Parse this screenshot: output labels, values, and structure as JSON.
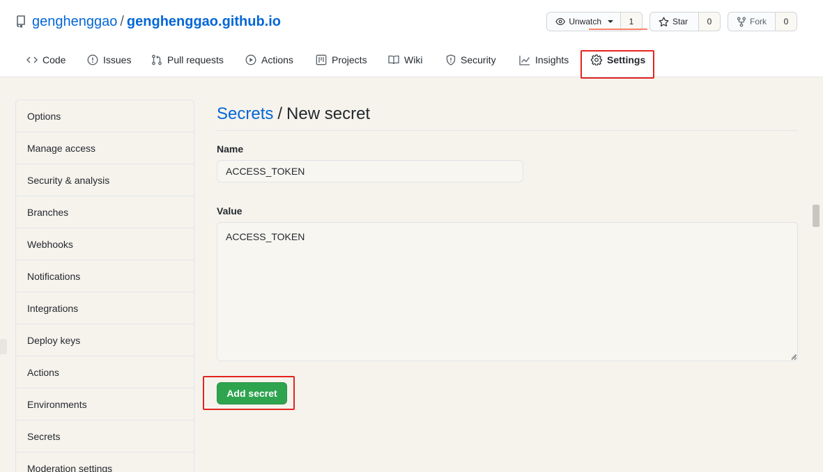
{
  "repo": {
    "owner": "genghenggao",
    "separator": "/",
    "name": "genghenggao.github.io"
  },
  "actions": {
    "watch": {
      "label": "Unwatch",
      "count": "1"
    },
    "star": {
      "label": "Star",
      "count": "0"
    },
    "fork": {
      "label": "Fork",
      "count": "0"
    }
  },
  "tabs": [
    {
      "label": "Code",
      "icon": "code-icon"
    },
    {
      "label": "Issues",
      "icon": "issue-icon"
    },
    {
      "label": "Pull requests",
      "icon": "pull-request-icon"
    },
    {
      "label": "Actions",
      "icon": "play-icon"
    },
    {
      "label": "Projects",
      "icon": "project-icon"
    },
    {
      "label": "Wiki",
      "icon": "book-icon"
    },
    {
      "label": "Security",
      "icon": "shield-icon"
    },
    {
      "label": "Insights",
      "icon": "graph-icon"
    },
    {
      "label": "Settings",
      "icon": "gear-icon",
      "selected": true
    }
  ],
  "sidebar": {
    "items": [
      {
        "label": "Options"
      },
      {
        "label": "Manage access"
      },
      {
        "label": "Security & analysis"
      },
      {
        "label": "Branches"
      },
      {
        "label": "Webhooks"
      },
      {
        "label": "Notifications"
      },
      {
        "label": "Integrations"
      },
      {
        "label": "Deploy keys"
      },
      {
        "label": "Actions"
      },
      {
        "label": "Environments"
      },
      {
        "label": "Secrets",
        "highlighted": true
      },
      {
        "label": "Moderation settings"
      }
    ]
  },
  "main": {
    "breadcrumb_link": "Secrets",
    "breadcrumb_sep": "/",
    "breadcrumb_current": "New secret",
    "name_label": "Name",
    "name_value": "ACCESS_TOKEN",
    "value_label": "Value",
    "value_text": "ACCESS_TOKEN",
    "submit_label": "Add secret"
  },
  "colors": {
    "link": "#0366d6",
    "primary_button": "#2ea44f",
    "annotation": "#e3241f",
    "tab_underline": "#f9826c",
    "page_background": "#f6f3ed"
  }
}
